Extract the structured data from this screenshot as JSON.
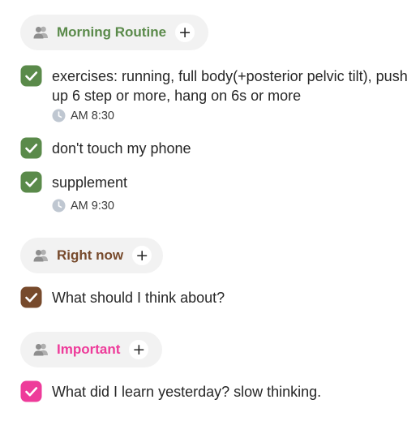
{
  "colors": {
    "pill_bg": "#f2f2f2",
    "clock_gray": "#bfc7d1",
    "people_icon": "#9a9a9a",
    "text": "#262626"
  },
  "groups": [
    {
      "title": "Morning Routine",
      "color": "#5a8a4a",
      "add_label": "+",
      "tasks": [
        {
          "text": "exercises: running, full body(+posterior pelvic tilt), push up 6 step or more, hang on 6s or more",
          "time": "AM 8:30",
          "checked": true
        },
        {
          "text": "don't touch my phone",
          "time": "",
          "checked": true
        },
        {
          "text": "supplement",
          "time": "AM 9:30",
          "checked": true
        }
      ]
    },
    {
      "title": "Right now",
      "color": "#774a2c",
      "add_label": "+",
      "tasks": [
        {
          "text": "What should I think about?",
          "time": "",
          "checked": true
        }
      ]
    },
    {
      "title": "Important",
      "color": "#ee3b9a",
      "add_label": "+",
      "tasks": [
        {
          "text": "What did I learn yesterday? slow thinking.",
          "time": "",
          "checked": true
        }
      ]
    }
  ]
}
